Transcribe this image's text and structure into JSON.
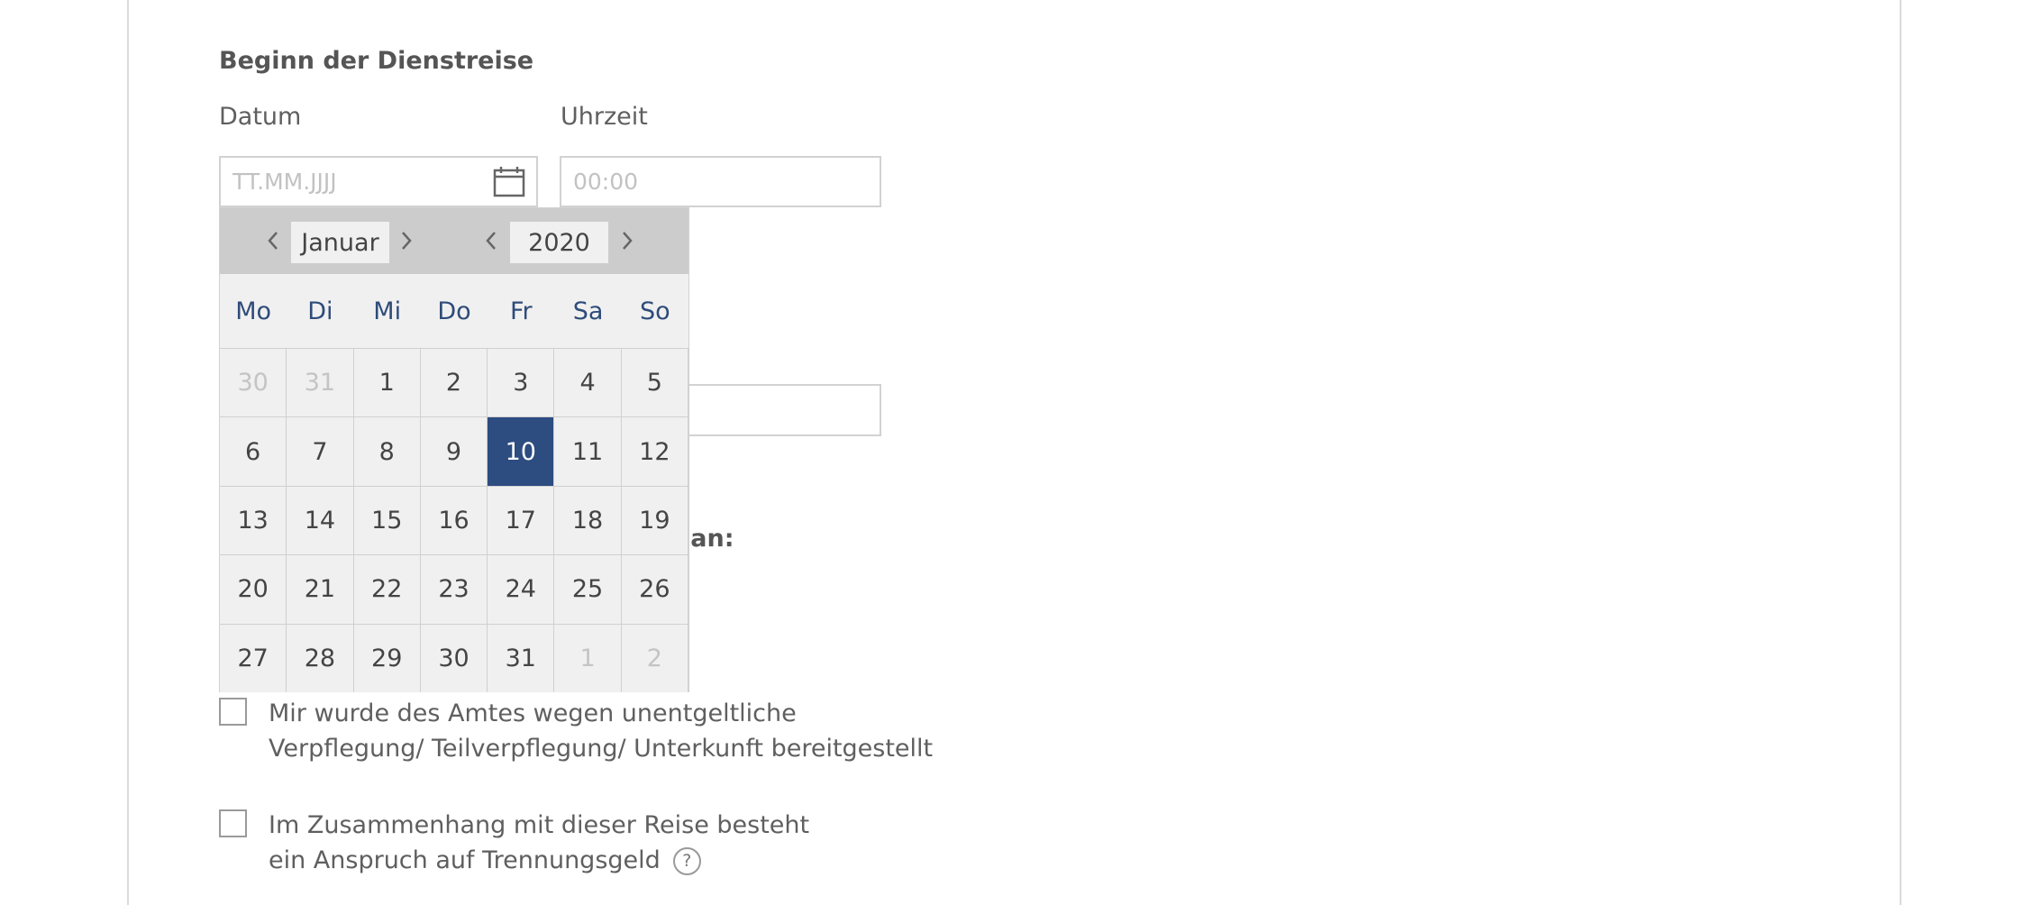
{
  "section": {
    "title": "Beginn der Dienstreise"
  },
  "date_field": {
    "label": "Datum",
    "placeholder": "TT.MM.JJJJ"
  },
  "time_field": {
    "label": "Uhrzeit",
    "placeholder": "00:00"
  },
  "partial_label": "gen an:",
  "datepicker": {
    "month": "Januar",
    "year": "2020",
    "weekdays": [
      "Mo",
      "Di",
      "Mi",
      "Do",
      "Fr",
      "Sa",
      "So"
    ],
    "days": [
      [
        "30",
        "31",
        "1",
        "2",
        "3",
        "4",
        "5"
      ],
      [
        "6",
        "7",
        "8",
        "9",
        "10",
        "11",
        "12"
      ],
      [
        "13",
        "14",
        "15",
        "16",
        "17",
        "18",
        "19"
      ],
      [
        "20",
        "21",
        "22",
        "23",
        "24",
        "25",
        "26"
      ],
      [
        "27",
        "28",
        "29",
        "30",
        "31",
        "1",
        "2"
      ]
    ],
    "selected_day": "10"
  },
  "checkboxes": {
    "verpflegung": {
      "line1": "Mir wurde des Amtes wegen unentgeltliche",
      "line2": "Verpflegung/ Teilverpflegung/ Unterkunft bereitgestellt"
    },
    "trennungsgeld": {
      "line1": "Im Zusammenhang mit dieser Reise besteht",
      "line2": "ein Anspruch auf Trennungsgeld",
      "help_glyph": "?"
    }
  },
  "colors": {
    "accent": "#2d4c80",
    "weekday": "#2e4b7a",
    "header": "#cccccc"
  }
}
